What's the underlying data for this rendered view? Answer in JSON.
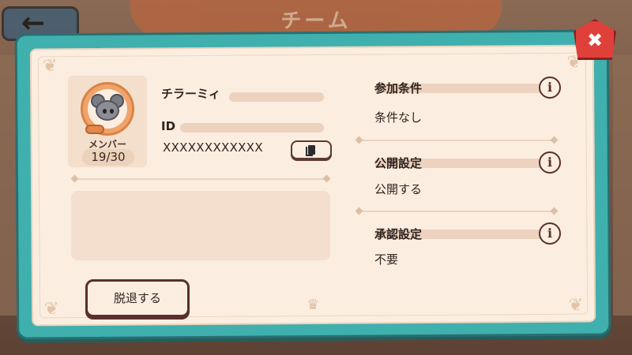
{
  "background": {
    "banner_text": "チーム"
  },
  "team": {
    "name_label": "チラーミィ",
    "id_label": "ID",
    "id_value": "XXXXXXXXXXXX",
    "member_label": "メンバー",
    "member_count": "19/30"
  },
  "actions": {
    "leave_label": "脱退する",
    "close_label": "✖"
  },
  "settings": [
    {
      "title": "参加条件",
      "value": "条件なし"
    },
    {
      "title": "公開設定",
      "value": "公開する"
    },
    {
      "title": "承認設定",
      "value": "不要"
    }
  ],
  "colors": {
    "frame": "#3fb0ad",
    "panel": "#fbeee0",
    "close": "#e0403a",
    "accent_orange": "#f0a36b"
  },
  "icons": {
    "close": "close-icon",
    "copy": "copy-icon",
    "info": "info-icon",
    "avatar": "mouse-avatar-icon"
  }
}
